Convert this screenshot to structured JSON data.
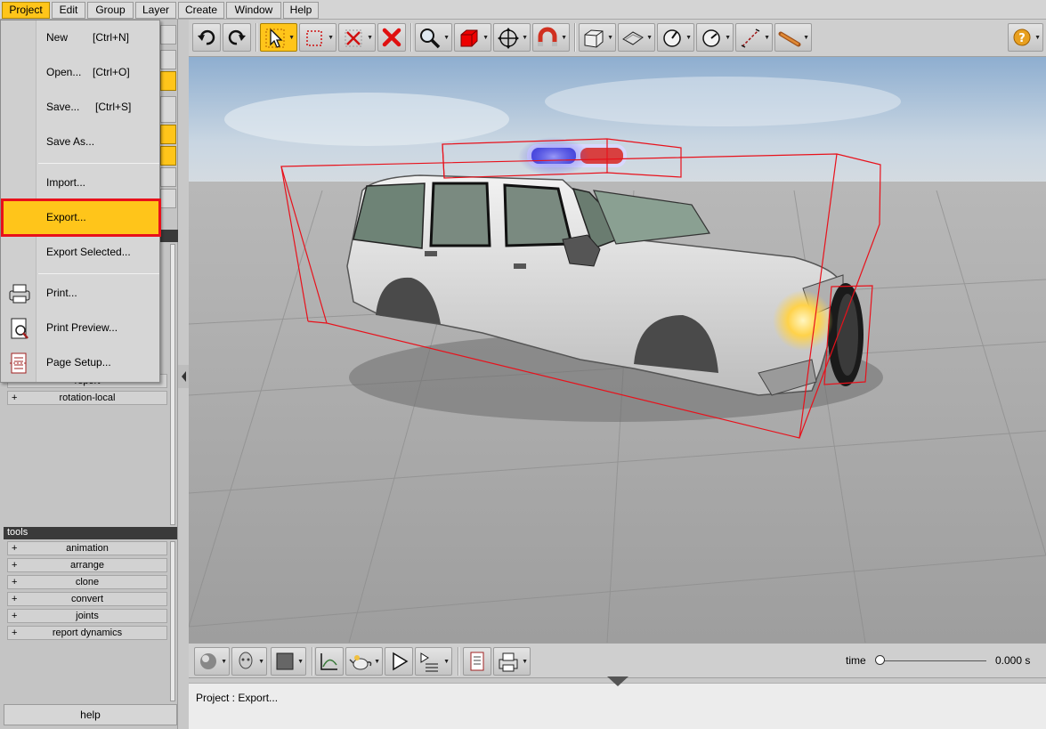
{
  "menubar": {
    "items": [
      "Project",
      "Edit",
      "Group",
      "Layer",
      "Create",
      "Window",
      "Help"
    ]
  },
  "project_menu": {
    "new": {
      "label": "New",
      "shortcut": "[Ctrl+N]"
    },
    "open": {
      "label": "Open...",
      "shortcut": "[Ctrl+O]"
    },
    "save": {
      "label": "Save...",
      "shortcut": "[Ctrl+S]"
    },
    "save_as": {
      "label": "Save As..."
    },
    "import": {
      "label": "Import..."
    },
    "export": {
      "label": "Export..."
    },
    "export_selected": {
      "label": "Export Selected..."
    },
    "print": {
      "label": "Print..."
    },
    "print_preview": {
      "label": "Print Preview..."
    },
    "page_setup": {
      "label": "Page Setup..."
    }
  },
  "left_panel": {
    "tree_partial": "report",
    "tree_item": "rotation-local",
    "tools_header": "tools",
    "tools": [
      "animation",
      "arrange",
      "clone",
      "convert",
      "joints",
      "report dynamics"
    ],
    "expand_symbol": "+",
    "help": "help"
  },
  "bottom": {
    "time_label": "time",
    "time_value": "0.000 s",
    "time_position": 0
  },
  "status": {
    "text": "Project : Export..."
  },
  "colors": {
    "accent": "#ffc51a",
    "highlight_border": "#e8111b",
    "bounding_box": "#e8111b"
  }
}
